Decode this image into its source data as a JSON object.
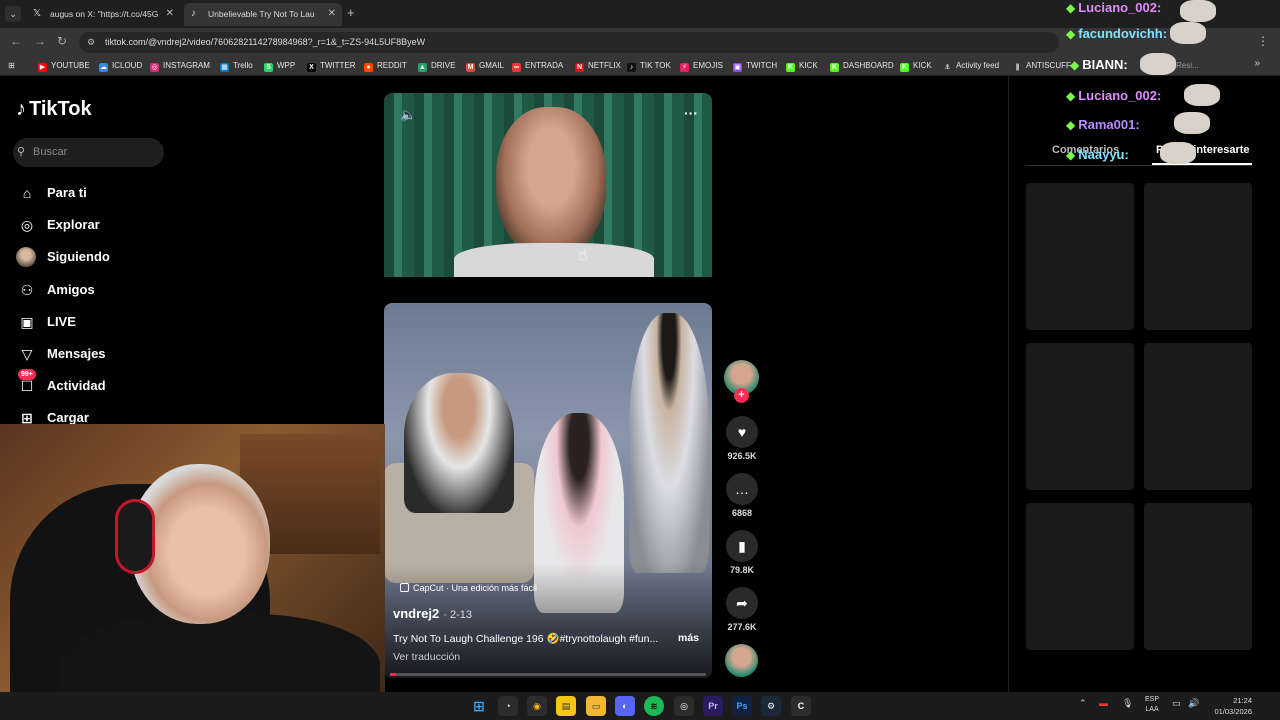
{
  "browser": {
    "tabs": [
      {
        "title": "augus on X: \"https://t.co/45G",
        "icon": "x-icon"
      },
      {
        "title": "Unbelievable Try Not To Lau",
        "icon": "tiktok-icon"
      }
    ],
    "url": "tiktok.com/@vndrej2/video/7606282114278984968?_r=1&_t=ZS-94L5UF8ByeW",
    "bookmarks": [
      {
        "label": "YOUTUBE",
        "color": "#ff0000",
        "glyph": "▶"
      },
      {
        "label": "ICLOUD",
        "color": "#3b82f6",
        "glyph": "☁"
      },
      {
        "label": "INSTAGRAM",
        "color": "#d62976",
        "glyph": "◎"
      },
      {
        "label": "Trello",
        "color": "#0079bf",
        "glyph": "▦"
      },
      {
        "label": "WPP",
        "color": "#25d366",
        "glyph": "S"
      },
      {
        "label": "TWITTER",
        "color": "#000000",
        "glyph": "X"
      },
      {
        "label": "REDDIT",
        "color": "#ff4500",
        "glyph": "●"
      },
      {
        "label": "DRIVE",
        "color": "#1fa463",
        "glyph": "▲"
      },
      {
        "label": "GMAIL",
        "color": "#ea4335",
        "glyph": "M"
      },
      {
        "label": "ENTRADA",
        "color": "#e53935",
        "glyph": "∞"
      },
      {
        "label": "NETFLIX",
        "color": "#e50914",
        "glyph": "N"
      },
      {
        "label": "TIK TOK",
        "color": "#111111",
        "glyph": "♪"
      },
      {
        "label": "EMOJIS",
        "color": "#e91e63",
        "glyph": "⚡"
      },
      {
        "label": "TWITCH",
        "color": "#9146ff",
        "glyph": "▣"
      },
      {
        "label": "KICK",
        "color": "#53fc18",
        "glyph": "K"
      },
      {
        "label": "DASHBOARD",
        "color": "#53fc18",
        "glyph": "K"
      },
      {
        "label": "KICK",
        "color": "#53fc18",
        "glyph": "K"
      },
      {
        "label": "Activity feed",
        "color": "#333333",
        "glyph": "⚓"
      },
      {
        "label": "ANTISCUFF",
        "color": "#333333",
        "glyph": "∥"
      }
    ],
    "bookmark_overflow": "Resi...",
    "colors": {
      "chrome_bg": "#353535",
      "tabbar_bg": "#1f1f1f"
    }
  },
  "tiktok": {
    "logo": "TikTok",
    "search_placeholder": "Buscar",
    "nav": [
      {
        "label": "Para ti",
        "icon": "home-icon",
        "glyph": "⌂"
      },
      {
        "label": "Explorar",
        "icon": "compass-icon",
        "glyph": "◎"
      },
      {
        "label": "Siguiendo",
        "icon": "avatar-icon",
        "glyph": ""
      },
      {
        "label": "Amigos",
        "icon": "friends-icon",
        "glyph": "⚇"
      },
      {
        "label": "LIVE",
        "icon": "live-icon",
        "glyph": "▣"
      },
      {
        "label": "Mensajes",
        "icon": "send-icon",
        "glyph": "▽"
      },
      {
        "label": "Actividad",
        "icon": "inbox-icon",
        "glyph": "☐",
        "badge": "99+"
      },
      {
        "label": "Cargar",
        "icon": "upload-icon",
        "glyph": "⊞"
      }
    ],
    "video": {
      "capcut_label": "CapCut · Una edición más fácil",
      "author": "vndrej2",
      "date": "2-13",
      "caption": "Try Not To Laugh Challenge 196 🤣#trynottolaugh #fun...",
      "more": "más",
      "translate": "Ver traducción",
      "progress": 0.02
    },
    "actions": {
      "likes": "926.5K",
      "comments": "6868",
      "saves": "79.8K",
      "shares": "277.6K"
    },
    "panel_tabs": [
      "Comentarios",
      "Podría interesarte"
    ],
    "accent": "#fe2c55"
  },
  "chat": [
    {
      "user": "Luciano_002:",
      "color": "#e08bff"
    },
    {
      "user": "facundovichh:",
      "color": "#7fe3ff"
    },
    {
      "user": "BIANN:",
      "color": "#ffffff"
    },
    {
      "user": "Luciano_002:",
      "color": "#e08bff"
    },
    {
      "user": "Rama001:",
      "color": "#b98bff"
    },
    {
      "user": "Naayyu:",
      "color": "#7fe3ff"
    }
  ],
  "taskbar": {
    "lang_top": "ESP",
    "lang_bottom": "LAA",
    "time": "21:24",
    "date": "01/03/2026"
  }
}
